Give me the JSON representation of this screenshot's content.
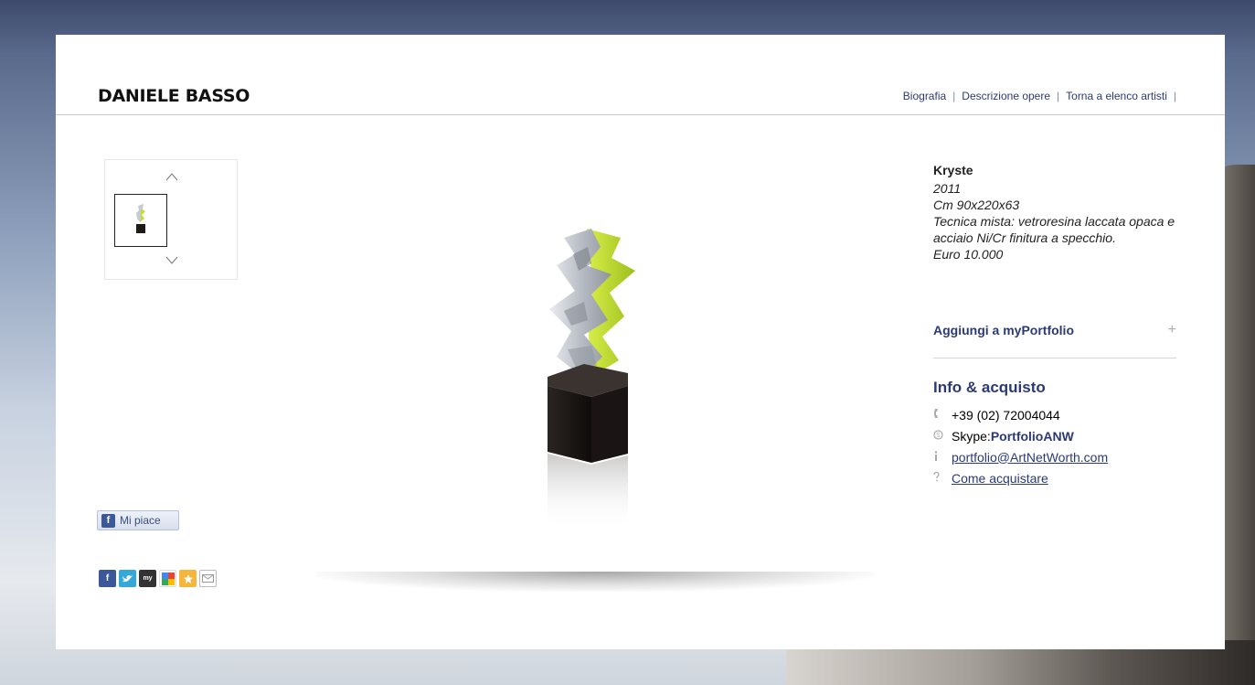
{
  "header": {
    "artist_name": "DANIELE BASSO",
    "nav": [
      "Biografia",
      "Descrizione opere",
      "Torna a elenco artisti"
    ]
  },
  "thumbnails": {
    "up_icon": "chevron-up-icon",
    "down_icon": "chevron-down-icon"
  },
  "artwork": {
    "title": "Kryste",
    "year": "2011",
    "dimensions": "Cm 90x220x63",
    "technique": "Tecnica mista: vetroresina laccata opaca e acciaio Ni/Cr finitura a specchio.",
    "price": "Euro 10.000"
  },
  "portfolio": {
    "add_label": "Aggiungi a myPortfolio",
    "add_icon": "+"
  },
  "contact": {
    "title": "Info & acquisto",
    "phone": "+39 (02) 72004044",
    "skype_label": "Skype: ",
    "skype_name": "PortfolioANW",
    "email": "portfolio@ArtNetWorth.com",
    "how_to_buy": "Come acquistare"
  },
  "social": {
    "like_label": "Mi piace",
    "share_icons": [
      "facebook-icon",
      "twitter-icon",
      "myspace-icon",
      "google-icon",
      "bookmark-icon",
      "email-icon"
    ]
  },
  "colors": {
    "accent": "#2b3a75",
    "facebook": "#3b5998",
    "sculpture_green": "#c3df2a",
    "sculpture_silver": "#c7cbd1",
    "base": "#1e1a18"
  }
}
